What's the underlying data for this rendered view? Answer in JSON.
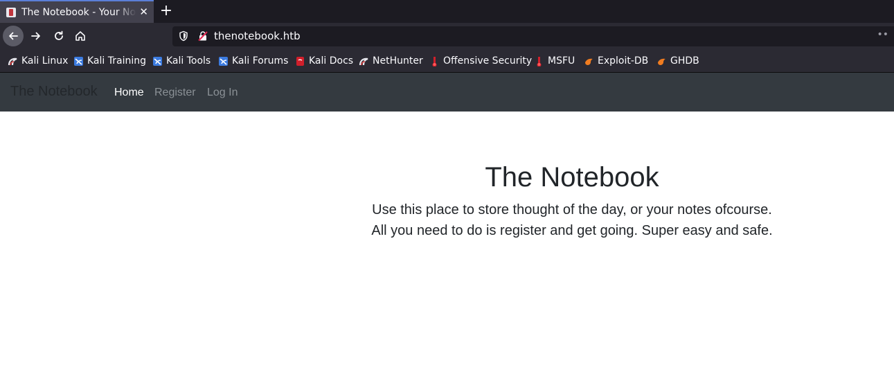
{
  "browser": {
    "tab": {
      "title": "The Notebook - Your Notes",
      "close_glyph": "✕"
    },
    "new_tab_glyph": "+",
    "url": "thenotebook.htb",
    "bookmarks": [
      {
        "label": "Kali Linux",
        "icon": "kali-dragon-icon"
      },
      {
        "label": "Kali Training",
        "icon": "kali-training-icon"
      },
      {
        "label": "Kali Tools",
        "icon": "kali-tools-icon"
      },
      {
        "label": "Kali Forums",
        "icon": "kali-forums-icon"
      },
      {
        "label": "Kali Docs",
        "icon": "kali-docs-icon"
      },
      {
        "label": "NetHunter",
        "icon": "nethunter-icon"
      },
      {
        "label": "Offensive Security",
        "icon": "offsec-icon"
      },
      {
        "label": "MSFU",
        "icon": "msfu-icon"
      },
      {
        "label": "Exploit-DB",
        "icon": "exploit-db-icon"
      },
      {
        "label": "GHDB",
        "icon": "ghdb-icon"
      }
    ]
  },
  "site": {
    "brand": "The Notebook",
    "nav": {
      "home": "Home",
      "register": "Register",
      "login": "Log In"
    },
    "hero": {
      "title": "The Notebook",
      "line1": "Use this place to store thought of the day, or your notes ofcourse.",
      "line2": "All you need to do is register and get going. Super easy and safe."
    }
  },
  "colors": {
    "navbar_bg": "#343a40",
    "browser_bg": "#2b2a33",
    "tabstrip_bg": "#1c1b22",
    "active_link": "#ffffff",
    "muted_link": "#8b9196",
    "text": "#212529"
  }
}
